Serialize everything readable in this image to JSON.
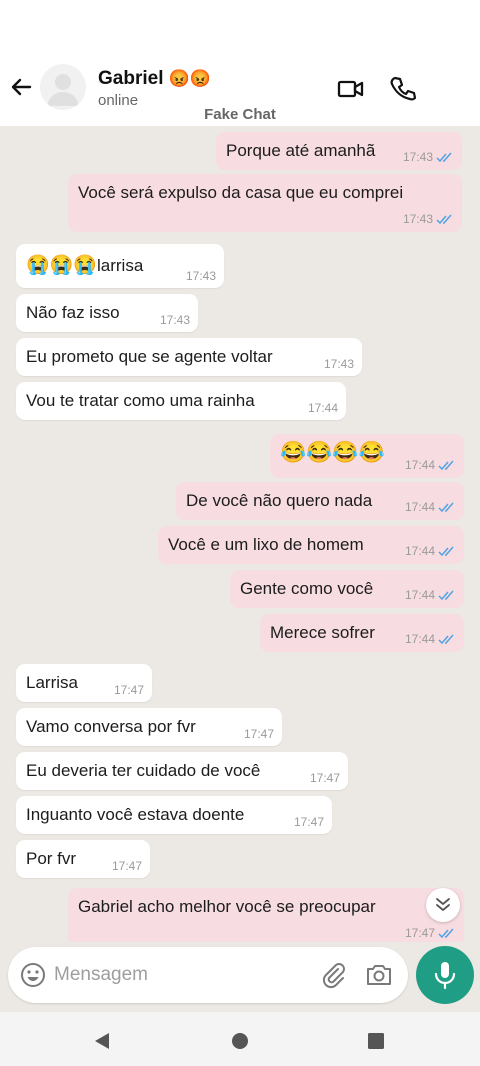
{
  "header": {
    "contact_name": "Gabriel",
    "name_emoji": "😡😡",
    "presence": "online",
    "watermark": "Fake Chat",
    "icons": [
      "back-arrow-icon",
      "avatar-placeholder-icon",
      "video-call-icon",
      "voice-call-icon"
    ]
  },
  "messages": [
    {
      "dir": "out",
      "text": "Porque até amanhã",
      "time": "17:43"
    },
    {
      "dir": "out",
      "text": "Você será expulso da casa que eu comprei",
      "time": "17:43"
    },
    {
      "dir": "in",
      "emoji": "😭😭😭",
      "text": "larrisa",
      "time": "17:43"
    },
    {
      "dir": "in",
      "text": "Não faz isso",
      "time": "17:43"
    },
    {
      "dir": "in",
      "text": "Eu prometo que se agente voltar",
      "time": "17:43"
    },
    {
      "dir": "in",
      "text": "Vou te tratar como uma rainha",
      "time": "17:44"
    },
    {
      "dir": "out",
      "emoji": "😂😂😂😂",
      "text": "",
      "time": "17:44"
    },
    {
      "dir": "out",
      "text": "De você não quero nada",
      "time": "17:44"
    },
    {
      "dir": "out",
      "text": "Você e um lixo de homem",
      "time": "17:44"
    },
    {
      "dir": "out",
      "text": "Gente como você",
      "time": "17:44"
    },
    {
      "dir": "out",
      "text": "Merece sofrer",
      "time": "17:44"
    },
    {
      "dir": "in",
      "text": "Larrisa",
      "time": "17:47"
    },
    {
      "dir": "in",
      "text": "Vamo conversa por fvr",
      "time": "17:47"
    },
    {
      "dir": "in",
      "text": "Eu deveria ter cuidado de você",
      "time": "17:47"
    },
    {
      "dir": "in",
      "text": "Inguanto você estava doente",
      "time": "17:47"
    },
    {
      "dir": "in",
      "text": "Por fvr",
      "time": "17:47"
    },
    {
      "dir": "out",
      "text": "Gabriel acho melhor você se preocupar",
      "time": "17:47"
    }
  ],
  "composer": {
    "placeholder": "Mensagem",
    "icons": [
      "emoji-icon",
      "attach-icon",
      "camera-icon",
      "mic-icon"
    ]
  },
  "colors": {
    "outgoing_bubble": "#f7dce1",
    "incoming_bubble": "#ffffff",
    "chat_background": "#ece8e3",
    "read_ticks": "#4fa3e6",
    "mic_button": "#1f9e85"
  }
}
